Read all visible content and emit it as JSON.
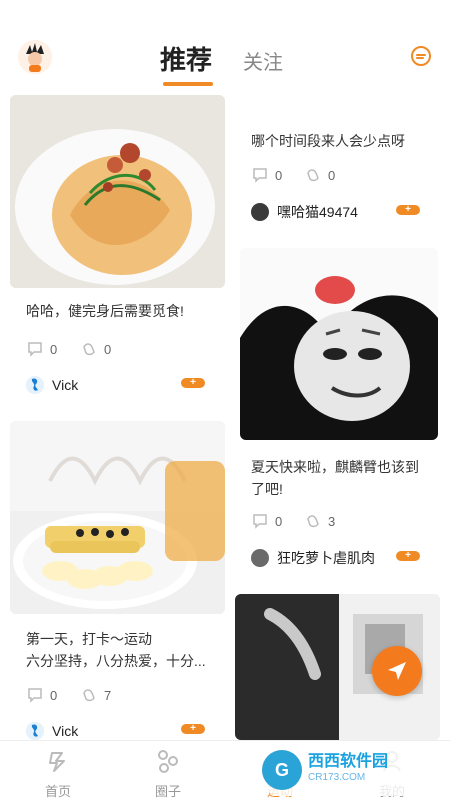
{
  "header": {
    "tabs": [
      {
        "label": "推荐",
        "active": true
      },
      {
        "label": "关注",
        "active": false
      }
    ],
    "accent": "#f08a24"
  },
  "feed": {
    "left": [
      {
        "image": "pasta-dish",
        "text": "哈哈，健完身后需要觅食!",
        "comments": "0",
        "likes": "0",
        "user": "Vick",
        "plus": "+"
      },
      {
        "image": "banana-pancake",
        "text": "第一天，打卡～运动\n六分坚持，八分热爱，十分...",
        "comments": "0",
        "likes": "7",
        "user": "Vick",
        "plus": "+"
      }
    ],
    "right": [
      {
        "text": "哪个时间段来人会少点呀",
        "comments": "0",
        "likes": "0",
        "user": "嘿哈猫49474",
        "plus": "+"
      },
      {
        "image": "panda-meme",
        "text": "夏天快来啦，麒麟臂也该到\n了吧!",
        "comments": "0",
        "likes": "3",
        "user": "狂吃萝卜虐肌肉",
        "plus": "+"
      },
      {
        "image": "workout-photo"
      }
    ]
  },
  "bottom_nav": [
    {
      "label": "首页",
      "icon": "home-icon",
      "active": false
    },
    {
      "label": "圈子",
      "icon": "circle-icon",
      "active": false
    },
    {
      "label": "运动",
      "icon": "sport-icon",
      "active": true
    },
    {
      "label": "我的",
      "icon": "profile-icon",
      "active": false
    }
  ],
  "watermark": {
    "logo": "G",
    "cn": "西西软件园",
    "en": "CR173.COM"
  }
}
